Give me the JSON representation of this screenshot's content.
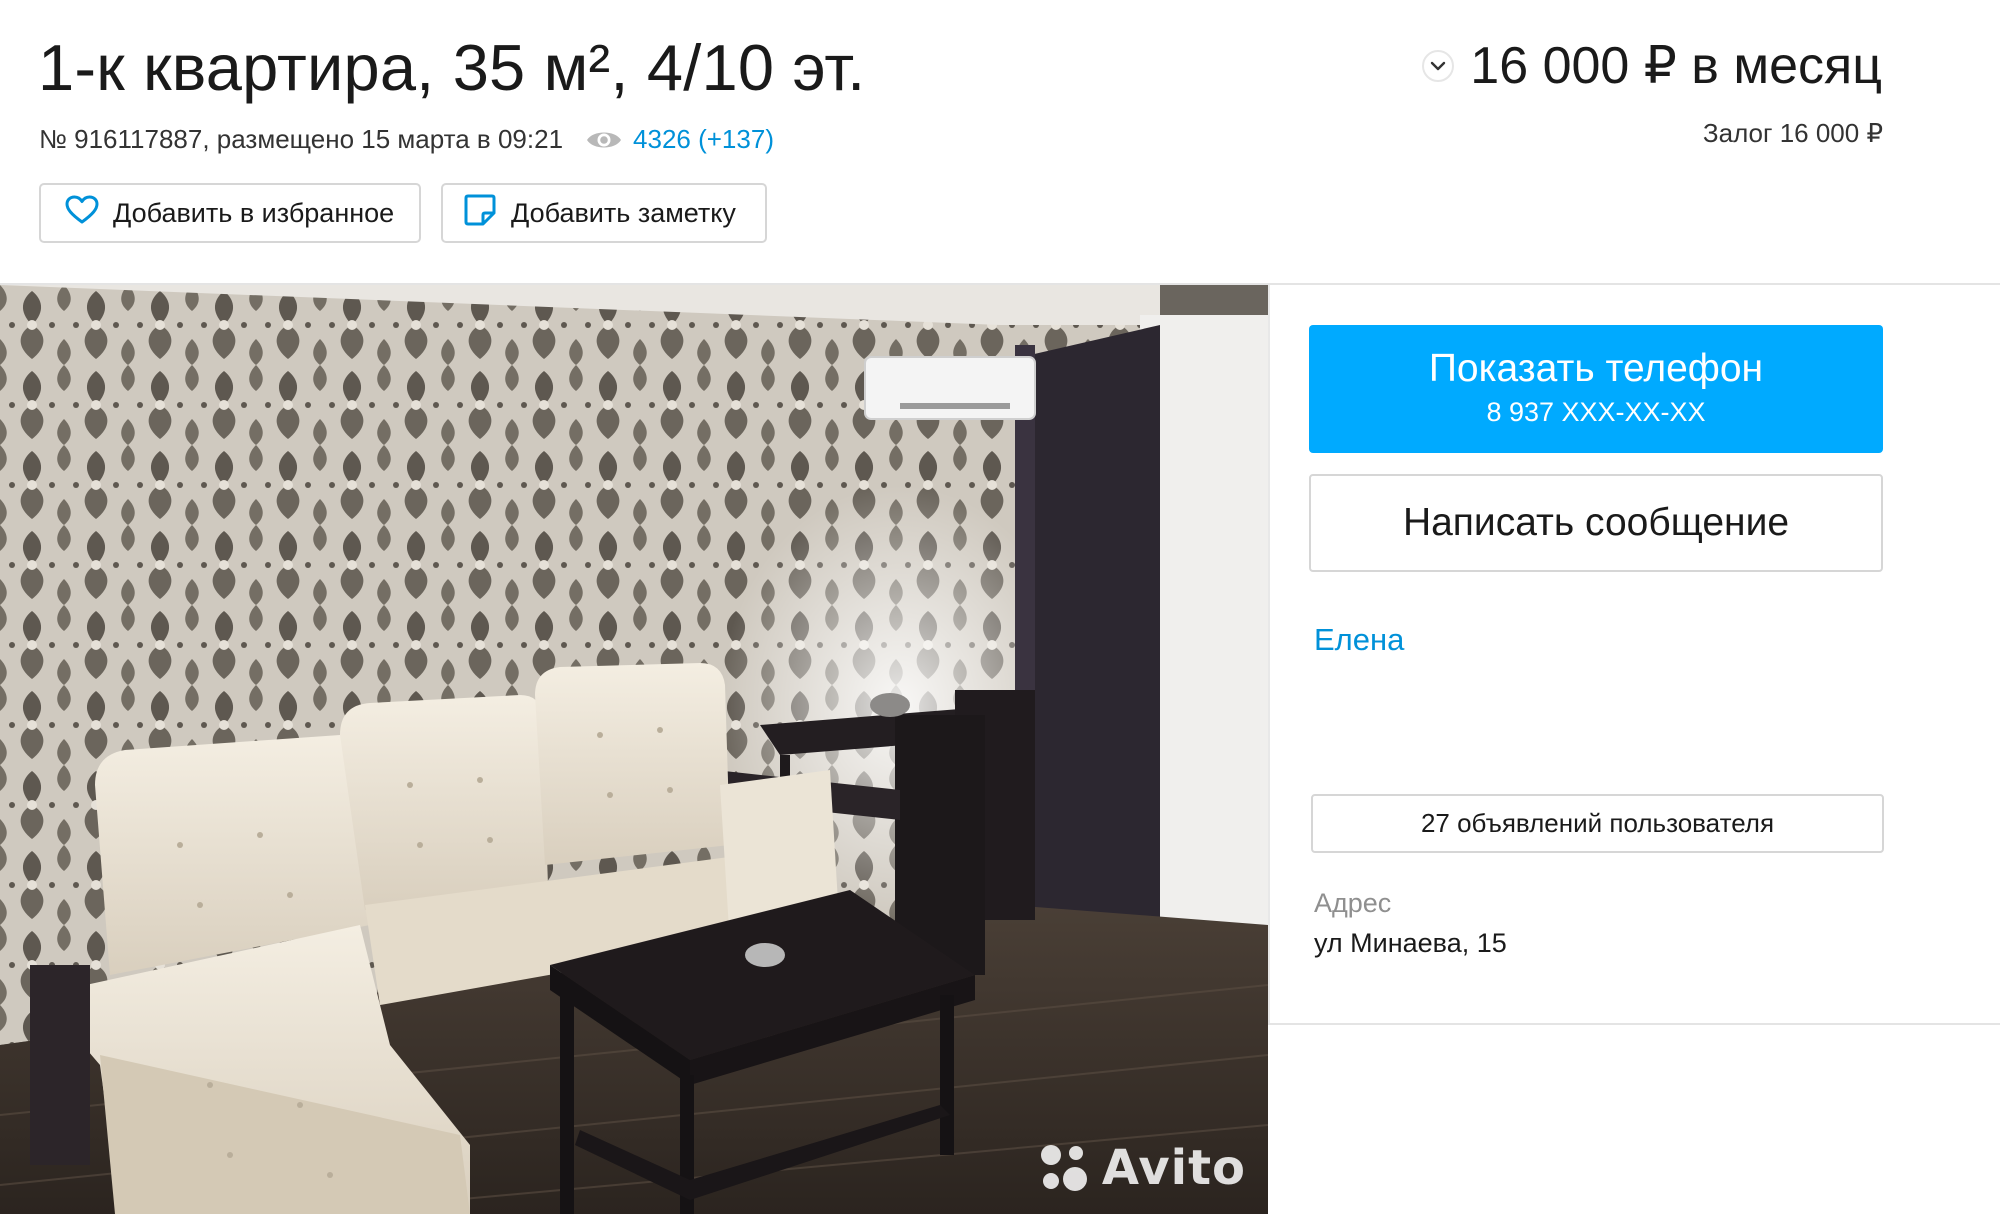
{
  "listing": {
    "title": "1-к квартира, 35 м², 4/10 эт.",
    "meta": "№ 916117887, размещено 15 марта в 09:21",
    "views": "4326 (+137)",
    "price": "16 000 ₽ в месяц",
    "deposit": "Залог 16 000 ₽"
  },
  "actions": {
    "favorite_label": "Добавить в избранное",
    "note_label": "Добавить заметку"
  },
  "contact": {
    "show_phone_label": "Показать телефон",
    "phone_masked": "8 937 XXX-XX-XX",
    "message_label": "Написать сообщение",
    "seller_name": "Елена",
    "seller_ads_label": "27 объявлений пользователя",
    "address_label": "Адрес",
    "address_value": "ул Минаева, 15"
  },
  "photo": {
    "watermark": "Avito"
  },
  "icons": {
    "favorite": "heart-icon",
    "note": "sticky-note-icon",
    "views": "eye-icon",
    "price_toggle": "chevron-down-icon"
  },
  "colors": {
    "accent_blue": "#00aaff",
    "link_blue": "#0091d9"
  }
}
